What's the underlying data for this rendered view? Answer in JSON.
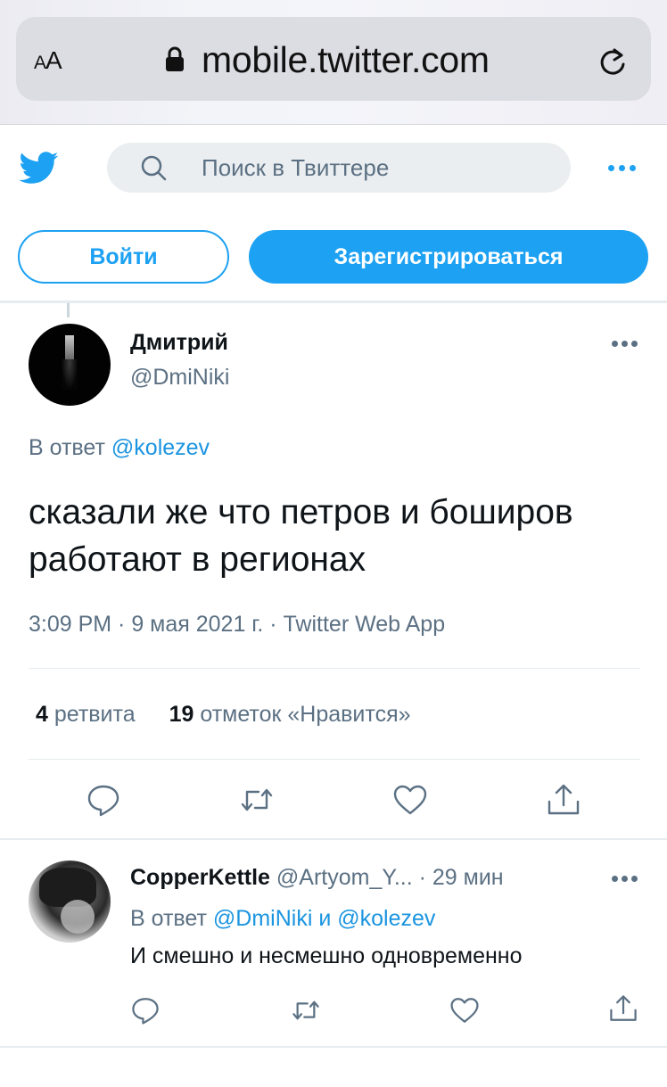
{
  "browser": {
    "text_size_label_small": "A",
    "text_size_label_large": "A",
    "url": "mobile.twitter.com"
  },
  "header": {
    "search_placeholder": "Поиск в Твиттере"
  },
  "auth": {
    "login_label": "Войти",
    "signup_label": "Зарегистрироваться"
  },
  "tweet": {
    "author_name": "Дмитрий",
    "author_handle": "@DmiNiki",
    "reply_prefix": "В ответ ",
    "reply_to": "@kolezev",
    "text": "сказали же что петров и боширов работают в регионах",
    "meta": "3:09 PM · 9 мая 2021 г. · Twitter Web App",
    "retweets_count": "4",
    "retweets_label": " ретвита",
    "likes_count": "19",
    "likes_label": " отметок «Нравится»"
  },
  "reply": {
    "author_name": "CopperKettle",
    "author_handle": " @Artyom_Y...",
    "time": "  · 29 мин",
    "reply_prefix": "В ответ ",
    "reply_to_1": "@DmiNiki",
    "reply_and": " и ",
    "reply_to_2": "@kolezev",
    "text": "И смешно и несмешно одновременно"
  },
  "colors": {
    "accent": "#1da1f2",
    "link": "#1b95e0",
    "secondary_text": "#5b7083",
    "divider": "#e6ecf0"
  },
  "icons": [
    "lock-icon",
    "reload-icon",
    "twitter-bird-icon",
    "search-icon",
    "more-icon",
    "reply-icon",
    "retweet-icon",
    "like-icon",
    "share-icon"
  ]
}
